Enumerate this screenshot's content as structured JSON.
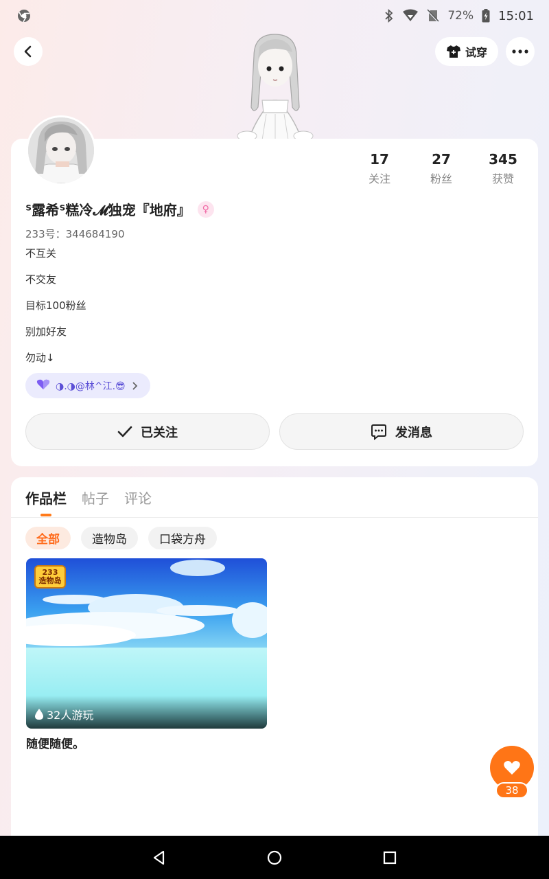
{
  "status_bar": {
    "battery": "72%",
    "time": "15:01",
    "icons": [
      "chrome-icon",
      "bluetooth-icon",
      "wifi-icon",
      "no-sim-icon",
      "battery-icon"
    ]
  },
  "header": {
    "tryon_label": "试穿",
    "icons": [
      "back-icon",
      "shirt-icon",
      "more-icon"
    ]
  },
  "profile": {
    "stats": [
      {
        "value": "17",
        "label": "关注"
      },
      {
        "value": "27",
        "label": "粉丝"
      },
      {
        "value": "345",
        "label": "获赞"
      }
    ],
    "nickname": "ᔆ露希ᔆ糕冷𝓜独宠『地府』",
    "gender_symbol": "♀",
    "uid": "233号：344684190",
    "bio": [
      "不互关",
      "不交友",
      "目标100粉丝",
      "别加好友",
      "勿动↓"
    ],
    "family_tag": "◑.◑@林^江.😎",
    "follow_label": "已关注",
    "message_label": "发消息"
  },
  "works": {
    "tabs": [
      {
        "label": "作品栏",
        "active": true
      },
      {
        "label": "帖子",
        "active": false
      },
      {
        "label": "评论",
        "active": false
      }
    ],
    "filters": [
      {
        "label": "全部",
        "active": true
      },
      {
        "label": "造物岛",
        "active": false
      },
      {
        "label": "口袋方舟",
        "active": false
      }
    ],
    "items": [
      {
        "logo_top": "233",
        "logo_bottom": "造物岛",
        "plays": "32人游玩",
        "title": "随便随便。"
      }
    ]
  },
  "like": {
    "count": "38"
  },
  "colors": {
    "accent": "#ff7516",
    "family_tag_bg": "#ebebfd",
    "active_chip_bg": "#fdeae0"
  }
}
